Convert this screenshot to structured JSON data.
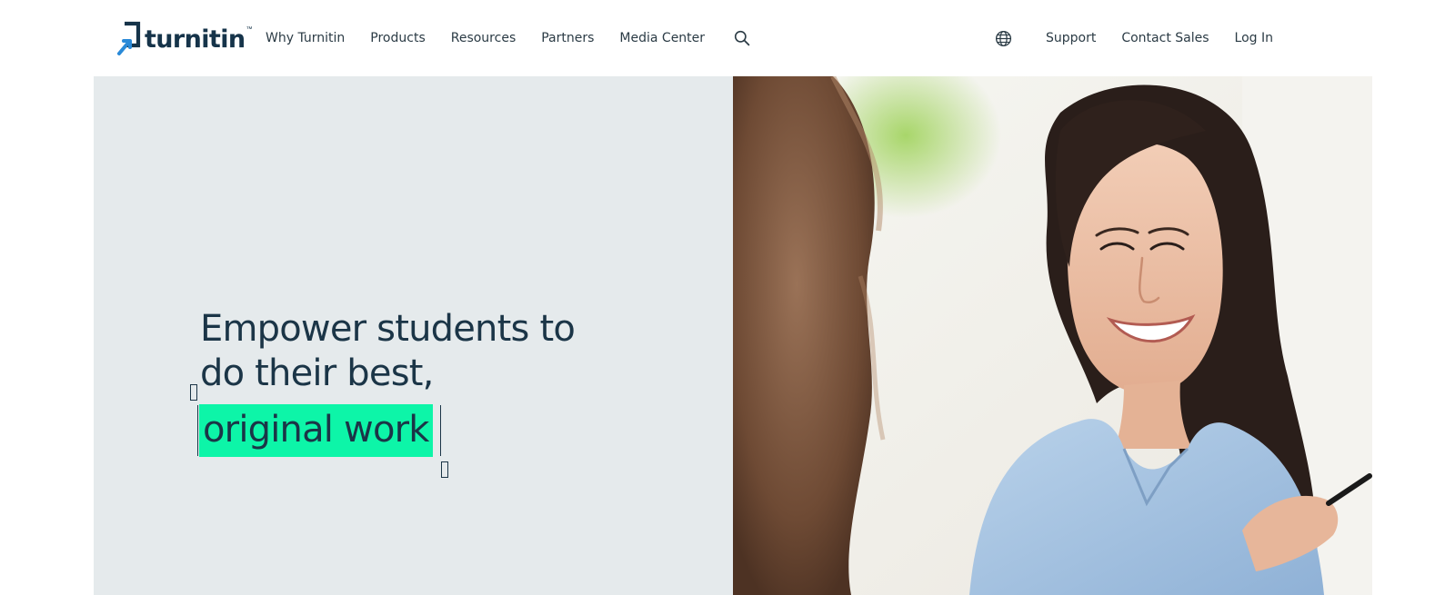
{
  "brand": {
    "name": "turnitin",
    "trademark": "™",
    "logo_icon": "turnitin-arrow-bracket-icon",
    "primary_color": "#16344a",
    "accent_color": "#2a8ad8"
  },
  "nav": {
    "left_links": [
      "Why Turnitin",
      "Products",
      "Resources",
      "Partners",
      "Media Center"
    ],
    "search_icon": "search-icon",
    "language_icon": "globe-icon",
    "right_links": [
      "Support",
      "Contact Sales",
      "Log In"
    ]
  },
  "hero": {
    "headline_line1": "Empower students to",
    "headline_line2": "do their best,",
    "highlighted_word": "original work",
    "highlight_color": "#0df5a8",
    "panel_color": "#e5eaec",
    "image": "smiling-student-photo"
  }
}
